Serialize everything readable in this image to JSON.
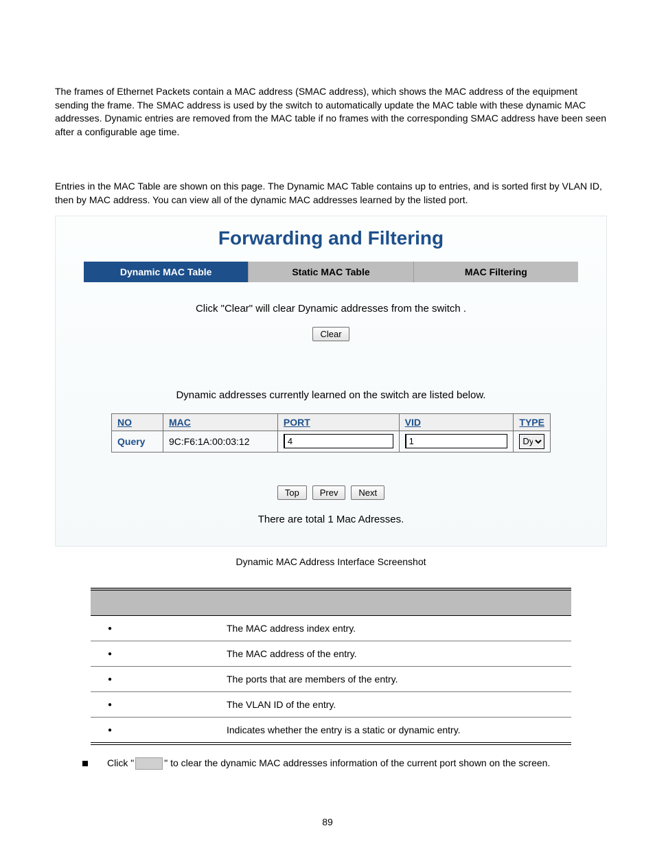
{
  "intro1": "The frames of Ethernet Packets contain a MAC address (SMAC address), which shows the MAC address of the equipment sending the frame. The SMAC address is used by the switch to automatically update the MAC table with these dynamic MAC addresses. Dynamic entries are removed from the MAC table if no frames with the corresponding SMAC address have been seen after a configurable age time.",
  "intro2a": "Entries in the MAC Table are shown on this page. The Dynamic MAC Table contains up to ",
  "intro2b": " entries, and is sorted first by VLAN ID, then by MAC address. You can view all of the dynamic MAC addresses learned by the listed port.",
  "panel": {
    "title": "Forwarding and Filtering",
    "tabs": [
      "Dynamic MAC Table",
      "Static MAC Table",
      "MAC Filtering"
    ],
    "clear_instruction": "Click \"Clear\" will clear Dynamic addresses from the switch .",
    "clear_label": "Clear",
    "learned_instruction": "Dynamic addresses currently learned on the switch are listed below.",
    "headers": {
      "no": "NO",
      "mac": "MAC",
      "port": "PORT",
      "vid": "VID",
      "type": "TYPE"
    },
    "row": {
      "label": "Query",
      "mac": "9C:F6:1A:00:03:12",
      "port": "4",
      "vid": "1",
      "type": "Dynamic"
    },
    "nav": {
      "top": "Top",
      "prev": "Prev",
      "next": "Next"
    },
    "total": "There are total 1 Mac Adresses."
  },
  "caption": "Dynamic MAC Address Interface Screenshot",
  "defs": [
    {
      "desc": "The MAC address index entry."
    },
    {
      "desc": "The MAC address of the entry."
    },
    {
      "desc": "The ports that are members of the entry."
    },
    {
      "desc": "The VLAN ID of the entry."
    },
    {
      "desc": "Indicates whether the entry is a static or dynamic entry."
    }
  ],
  "note_pre": "Click \"",
  "note_post": "\" to clear the dynamic MAC addresses information of the current port shown on the screen.",
  "page_number": "89"
}
